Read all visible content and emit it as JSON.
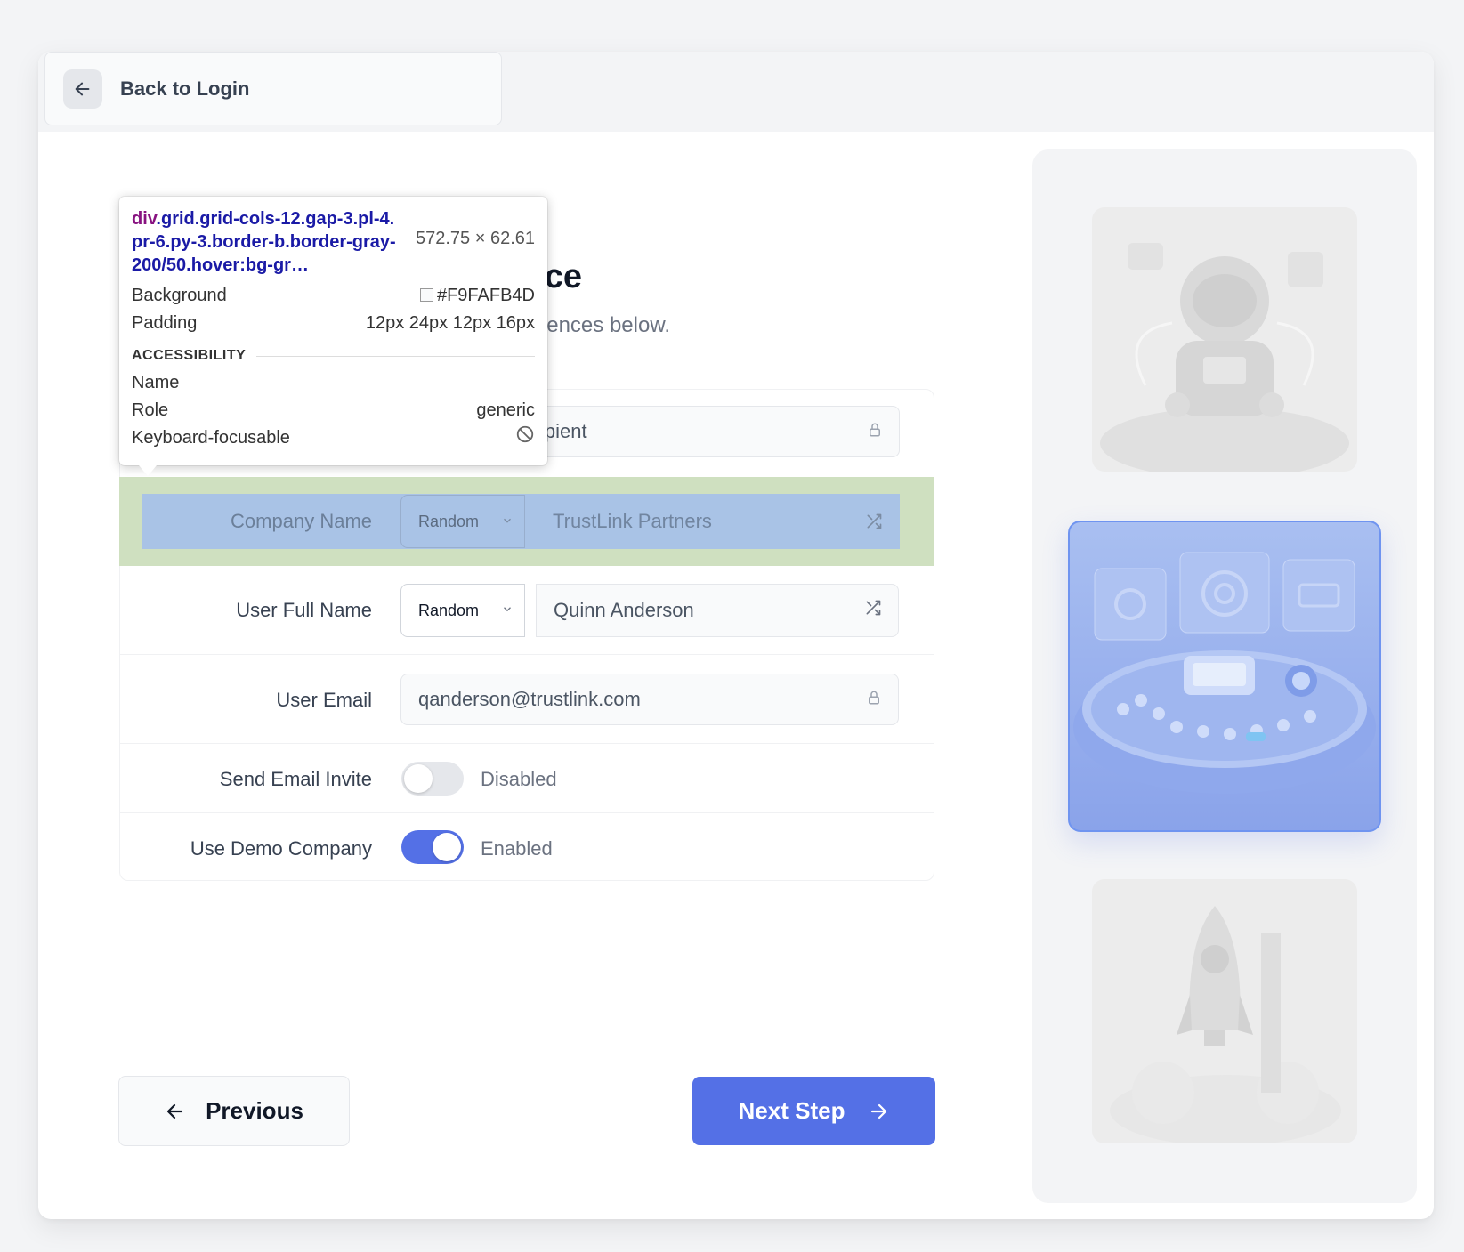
{
  "header": {
    "back_label": "Back to Login"
  },
  "main": {
    "heading_tail": "ce",
    "subheading_tail": "ences below."
  },
  "form": {
    "row1": {
      "value_tail": "ipient"
    },
    "company_name": {
      "label": "Company Name",
      "mode": "Random",
      "value": "TrustLink Partners"
    },
    "user_full_name": {
      "label": "User Full Name",
      "mode": "Random",
      "value": "Quinn Anderson"
    },
    "user_email": {
      "label": "User Email",
      "value": "qanderson@trustlink.com"
    },
    "send_email_invite": {
      "label": "Send Email Invite",
      "state": "Disabled",
      "on": false
    },
    "use_demo_company": {
      "label": "Use Demo Company",
      "state": "Enabled",
      "on": true
    }
  },
  "footer": {
    "previous_label": "Previous",
    "next_label": "Next Step"
  },
  "inspector": {
    "tag": "div",
    "selector": ".grid.grid-cols-12.gap-3.pl-4.pr-6.py-3.border-b.border-gray-200/50.hover:bg-gr…",
    "size": "572.75 × 62.61",
    "background_label": "Background",
    "background_value": "#F9FAFB4D",
    "padding_label": "Padding",
    "padding_value": "12px 24px 12px 16px",
    "section": "ACCESSIBILITY",
    "name_label": "Name",
    "role_label": "Role",
    "role_value": "generic",
    "focusable_label": "Keyboard-focusable"
  },
  "colors": {
    "accent": "#5470e6",
    "toggle_off": "#e5e7eb",
    "highlight_outer": "#cfe0c0",
    "highlight_inner": "#a9c3e6"
  },
  "icons": [
    "arrow-left-icon",
    "lock-icon",
    "chevron-down-icon",
    "shuffle-icon",
    "arrow-right-icon",
    "no-entry-icon"
  ]
}
